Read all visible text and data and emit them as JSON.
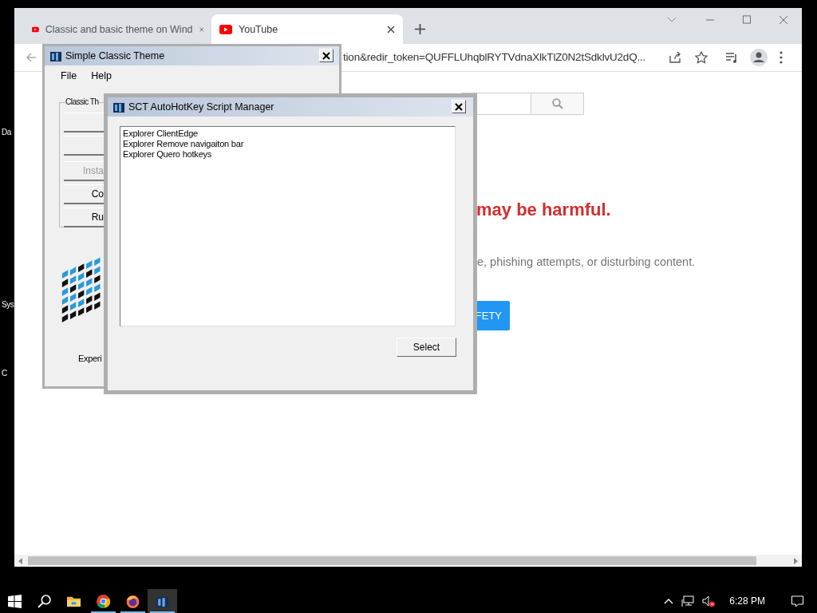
{
  "desktop_icons": [
    {
      "label": "Da"
    },
    {
      "label": "Sys"
    },
    {
      "label": "C"
    }
  ],
  "browser": {
    "tabs": [
      {
        "title": "Classic and basic theme on Wind",
        "selected": false
      },
      {
        "title": "YouTube",
        "selected": true
      }
    ],
    "address": "tion&redir_token=QUFFLUhqblRYTVdnaXlkTlZ0N2tSdklvU2dQ...",
    "page": {
      "heading": "may be harmful.",
      "body": "e, phishing attempts, or disturbing content.",
      "button": "FETY"
    }
  },
  "classic_theme_window": {
    "title": "Simple Classic Theme",
    "menu": [
      "File",
      "Help"
    ],
    "group_label": "Classic Th",
    "buttons": [
      {
        "kind": "blank"
      },
      {
        "kind": "blank"
      },
      {
        "kind": "labeled",
        "label": "Insta",
        "disabled": true
      },
      {
        "kind": "labeled",
        "label": "Co",
        "disabled": false
      },
      {
        "kind": "labeled",
        "label": "Ru",
        "disabled": false
      }
    ],
    "footer_text": "Experi"
  },
  "script_manager": {
    "title": "SCT AutoHotKey Script Manager",
    "scripts": [
      "Explorer ClientEdge",
      "Explorer Remove navigaiton bar",
      "Explorer Quero hotkeys"
    ],
    "select_button": "Select"
  },
  "taskbar": {
    "apps": [
      {
        "kind": "start",
        "running": false,
        "selected": false
      },
      {
        "kind": "search",
        "running": false,
        "selected": false
      },
      {
        "kind": "folder",
        "running": false,
        "selected": false
      },
      {
        "kind": "chrome",
        "running": true,
        "selected": false
      },
      {
        "kind": "firefox",
        "running": true,
        "selected": false
      },
      {
        "kind": "sct",
        "running": true,
        "selected": true
      }
    ],
    "muted": true,
    "clock": "6:28 PM"
  }
}
